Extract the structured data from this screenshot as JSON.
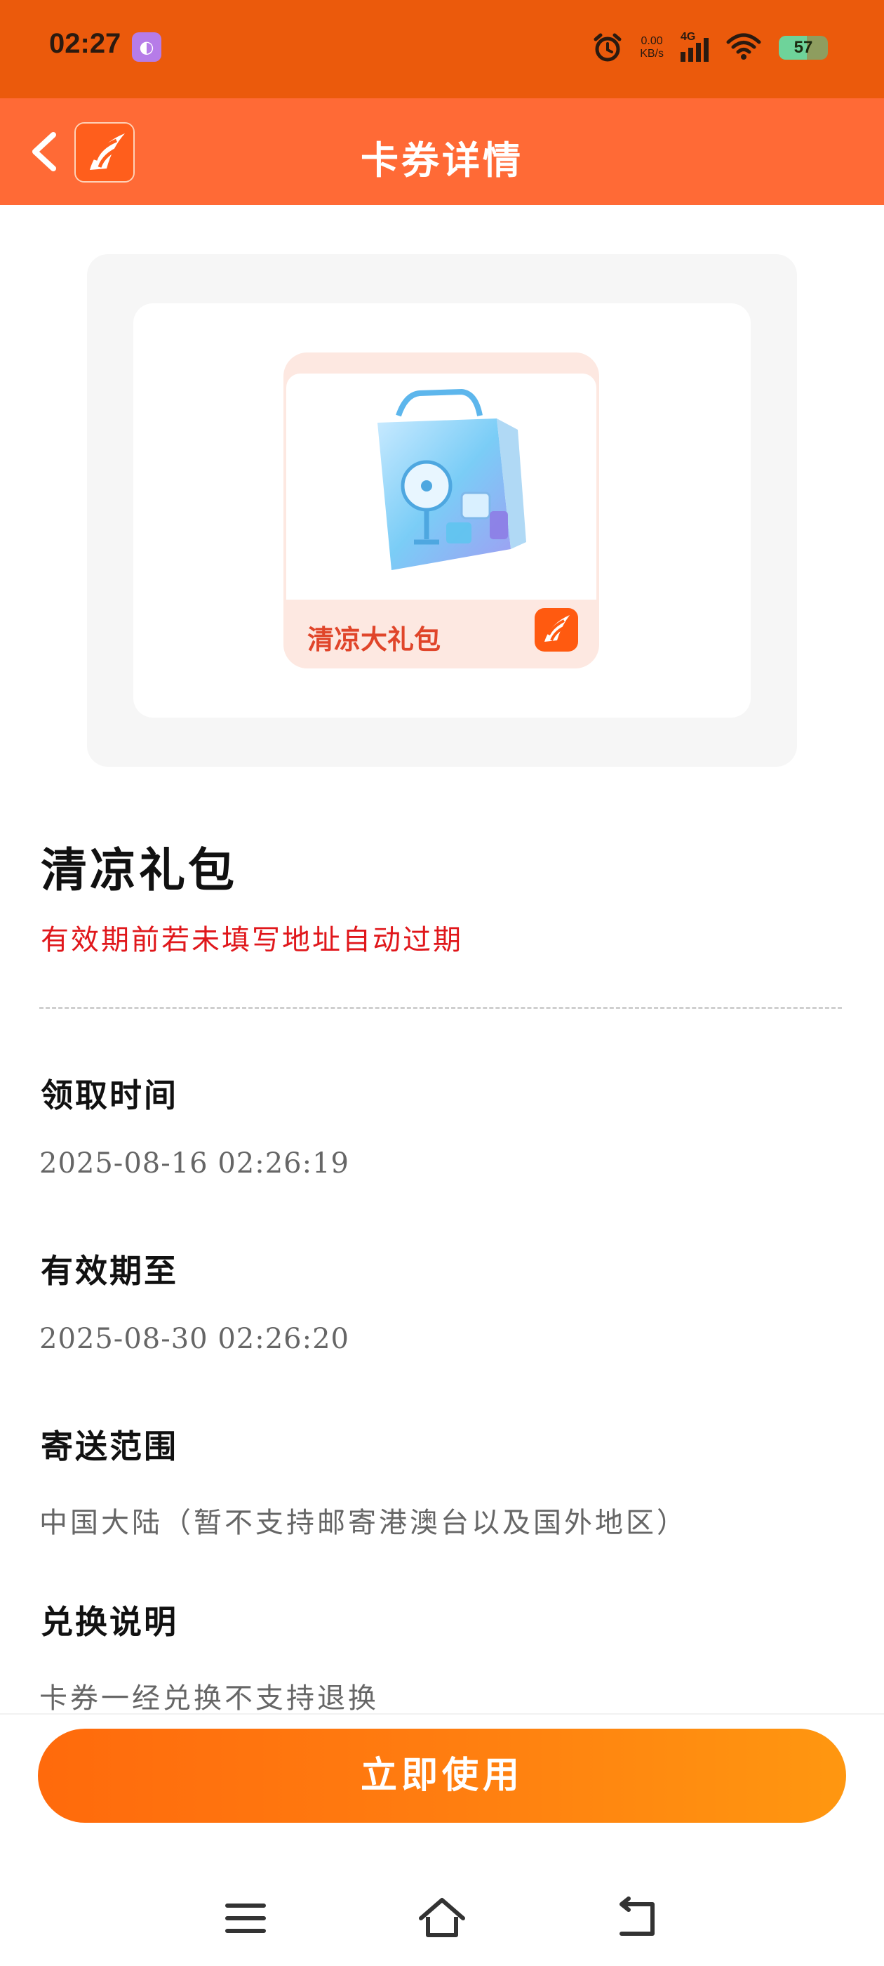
{
  "status_bar": {
    "time": "02:27",
    "speed_value": "0.00",
    "speed_unit": "KB/s",
    "network": "4G",
    "battery": 57
  },
  "header": {
    "title": "卡券详情"
  },
  "ticket": {
    "label": "清凉大礼包"
  },
  "product": {
    "title": "清凉礼包",
    "warning": "有效期前若未填写地址自动过期"
  },
  "details": [
    {
      "label": "领取时间",
      "value": "2025-08-16 02:26:19"
    },
    {
      "label": "有效期至",
      "value": "2025-08-30 02:26:20"
    },
    {
      "label": "寄送范围",
      "value": "中国大陆（暂不支持邮寄港澳台以及国外地区）"
    },
    {
      "label": "兑换说明",
      "value": "卡券一经兑换不支持退换"
    }
  ],
  "actions": {
    "use_label": "立即使用"
  },
  "colors": {
    "status_bar": "#eb5a0c",
    "header": "#ff6a36",
    "warning": "#e0171b",
    "button_start": "#ff6a0c",
    "button_end": "#ff9710"
  }
}
